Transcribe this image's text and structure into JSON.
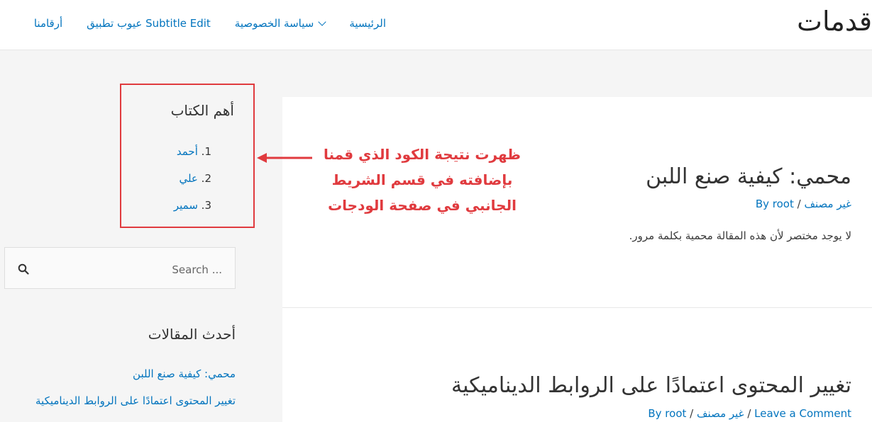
{
  "header": {
    "site_title": "قدمات",
    "nav": [
      {
        "label": "الرئيسية"
      },
      {
        "label": "سياسة الخصوصية"
      },
      {
        "label": "عيوب تطبيق Subtitle Edit"
      },
      {
        "label": "أرقامنا"
      }
    ]
  },
  "sidebar": {
    "authors_widget": {
      "title": "أهم الكتاب",
      "items": [
        {
          "num": "1.",
          "name": "أحمد"
        },
        {
          "num": "2.",
          "name": "علي"
        },
        {
          "num": "3.",
          "name": "سمير"
        }
      ]
    },
    "search": {
      "placeholder": "Search ..."
    },
    "recent_posts": {
      "title": "أحدث المقالات",
      "items": [
        "محمي: كيفية صنع اللبن",
        "تغيير المحتوى اعتمادًا على الروابط الديناميكية"
      ]
    }
  },
  "annotation": {
    "line1": "ظهرت نتيجة الكود الذي قمنا",
    "line2": "بإضافته في قسم الشريط",
    "line3": "الجانبي في صفحة الودجات",
    "color": "#e03a3e"
  },
  "posts": [
    {
      "title": "محمي: كيفية صنع اللبن",
      "category": "غير مصنف",
      "separator": "/",
      "author": "By root",
      "excerpt": "لا يوجد مختصر لأن هذه المقالة محمية بكلمة مرور."
    },
    {
      "title": "تغيير المحتوى اعتمادًا على الروابط الديناميكية",
      "leave_comment": "Leave a Comment",
      "separator": "/",
      "category": "غير مصنف",
      "author": "By root"
    }
  ],
  "colors": {
    "link": "#0274be",
    "accent": "#e03a3e"
  }
}
